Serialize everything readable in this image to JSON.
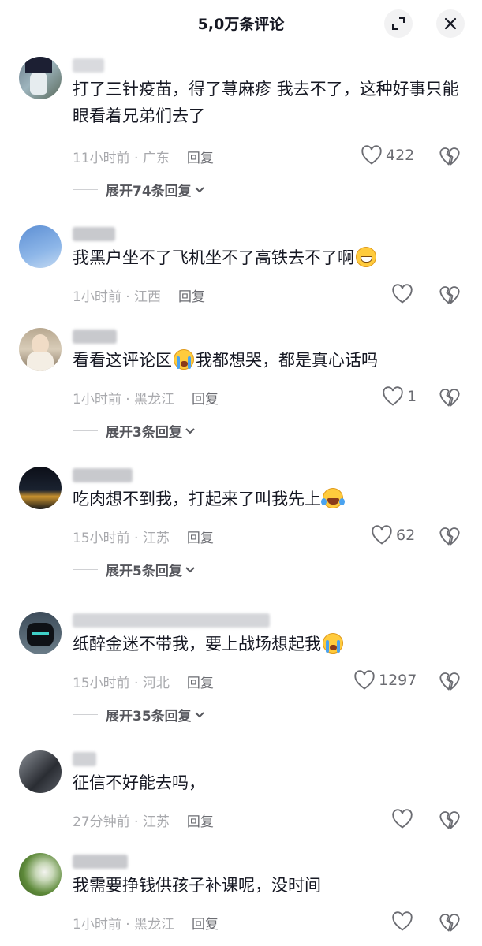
{
  "header": {
    "title": "5,0万条评论"
  },
  "reply_label": "回复",
  "comments": [
    {
      "text": "打了三针疫苗，得了荨麻疹 我去不了，这种好事只能眼看着兄弟们去了",
      "meta": "11小时前 · 广东",
      "likes": "422",
      "expand": "展开74条回复"
    },
    {
      "text": "我黑户坐不了飞机坐不了高铁去不了啊",
      "emoji": "grinning-face-emoji",
      "meta": "1小时前 · 江西",
      "likes": ""
    },
    {
      "text_before": "看看这评论区",
      "emoji": "loudly-crying-face-emoji",
      "text_after": "我都想哭，都是真心话吗",
      "meta": "1小时前 · 黑龙江",
      "likes": "1",
      "expand": "展开3条回复"
    },
    {
      "text": "吃肉想不到我，打起来了叫我先上",
      "emoji": "tears-of-joy-face-emoji",
      "meta": "15小时前 · 江苏",
      "likes": "62",
      "expand": "展开5条回复"
    },
    {
      "text": "纸醉金迷不带我，要上战场想起我",
      "emoji": "loudly-crying-face-emoji",
      "meta": "15小时前 · 河北",
      "likes": "1297",
      "expand": "展开35条回复"
    },
    {
      "text": "征信不好能去吗，",
      "meta": "27分钟前 · 江苏",
      "likes": ""
    },
    {
      "text": "我需要挣钱供孩子补课呢，没时间",
      "meta": "1小时前 · 黑龙江",
      "likes": ""
    }
  ],
  "colors": {
    "text": "#161823",
    "meta": "#a8a9ad",
    "icon": "#6b6c72"
  }
}
